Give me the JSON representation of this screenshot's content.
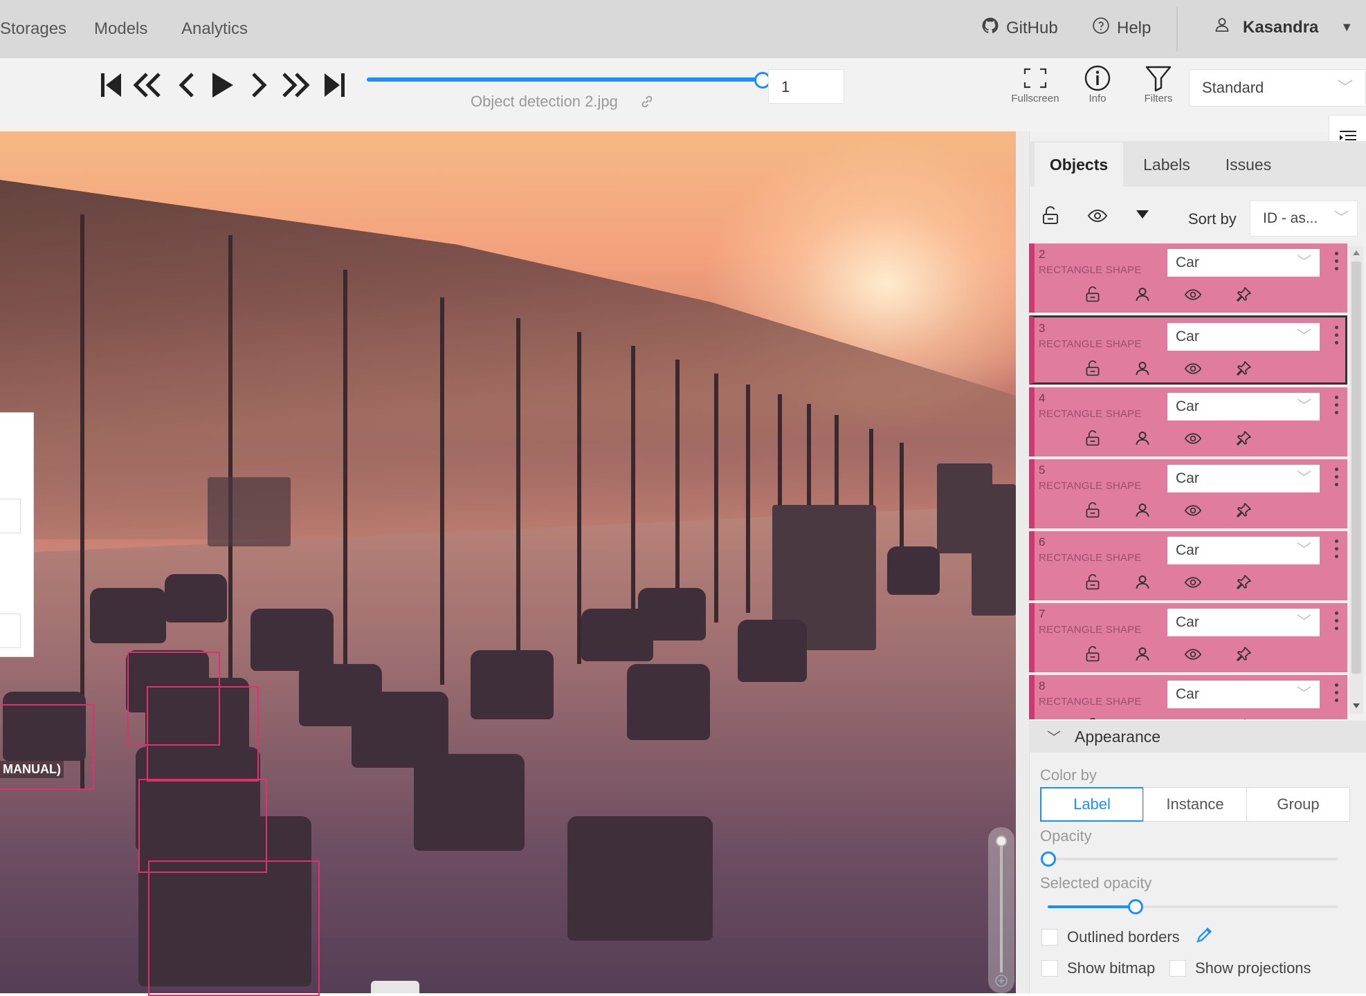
{
  "nav": {
    "items": [
      "Storages",
      "Models",
      "Analytics"
    ],
    "github": "GitHub",
    "help": "Help",
    "user": "Kasandra"
  },
  "player": {
    "frame": "1",
    "filename": "Object detection 2.jpg",
    "frame_progress": 1.0,
    "tools": {
      "fullscreen": "Fullscreen",
      "info": "Info",
      "filters": "Filters"
    },
    "workspace": "Standard"
  },
  "canvas": {
    "partial_label": "MANUAL)"
  },
  "sidebar": {
    "tabs": [
      "Objects",
      "Labels",
      "Issues"
    ],
    "active_tab": "Objects",
    "sort_by_label": "Sort by",
    "sort_value": "ID - as...",
    "objects": [
      {
        "id": "2",
        "type": "RECTANGLE SHAPE",
        "label": "Car",
        "selected": false
      },
      {
        "id": "3",
        "type": "RECTANGLE SHAPE",
        "label": "Car",
        "selected": true
      },
      {
        "id": "4",
        "type": "RECTANGLE SHAPE",
        "label": "Car",
        "selected": false
      },
      {
        "id": "5",
        "type": "RECTANGLE SHAPE",
        "label": "Car",
        "selected": false
      },
      {
        "id": "6",
        "type": "RECTANGLE SHAPE",
        "label": "Car",
        "selected": false
      },
      {
        "id": "7",
        "type": "RECTANGLE SHAPE",
        "label": "Car",
        "selected": false
      },
      {
        "id": "8",
        "type": "RECTANGLE SHAPE",
        "label": "Car",
        "selected": false
      }
    ],
    "object_color": "#e07c9e",
    "appearance": {
      "title": "Appearance",
      "color_by_label": "Color by",
      "color_by_options": [
        "Label",
        "Instance",
        "Group"
      ],
      "color_by_selected": "Label",
      "opacity_label": "Opacity",
      "opacity_value": 0,
      "selected_opacity_label": "Selected opacity",
      "selected_opacity_value": 0.3,
      "outlined_borders": "Outlined borders",
      "show_bitmap": "Show bitmap",
      "show_projections": "Show projections"
    }
  },
  "colors": {
    "accent": "#1890ff",
    "bbox": "#e0306d"
  }
}
